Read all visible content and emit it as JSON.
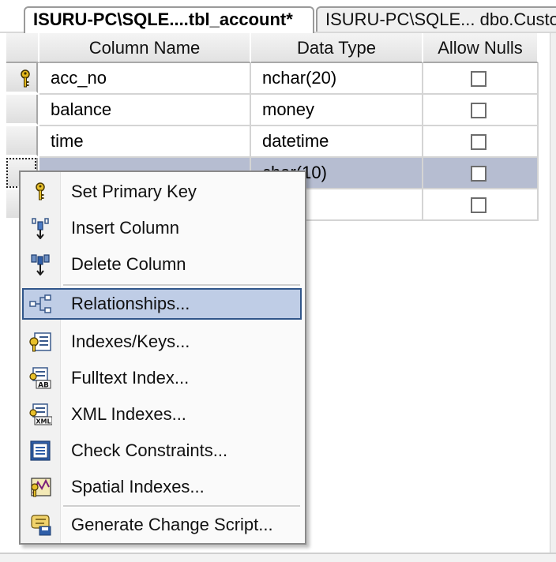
{
  "tabs": [
    {
      "label": "ISURU-PC\\SQLE....tbl_account*",
      "active": true
    },
    {
      "label": "ISURU-PC\\SQLE... dbo.Custo",
      "active": false
    }
  ],
  "grid": {
    "headers": {
      "column_name": "Column Name",
      "data_type": "Data Type",
      "allow_nulls": "Allow Nulls"
    },
    "rows": [
      {
        "name": "acc_no",
        "type": "nchar(20)",
        "allow_nulls": false,
        "primary_key": true
      },
      {
        "name": "balance",
        "type": "money",
        "allow_nulls": false,
        "primary_key": false
      },
      {
        "name": "time",
        "type": "datetime",
        "allow_nulls": false,
        "primary_key": false
      },
      {
        "name": "",
        "type": "char(10)",
        "allow_nulls": false,
        "primary_key": false,
        "selected": true
      },
      {
        "name": "",
        "type": "",
        "allow_nulls": false,
        "primary_key": false
      }
    ]
  },
  "context_menu": {
    "highlighted": "Relationships...",
    "items": [
      {
        "label": "Set Primary Key",
        "icon": "key-icon"
      },
      {
        "label": "Insert Column",
        "icon": "insert-column-icon"
      },
      {
        "label": "Delete Column",
        "icon": "delete-column-icon"
      },
      {
        "label": "Relationships...",
        "icon": "relationships-icon"
      },
      {
        "label": "Indexes/Keys...",
        "icon": "indexes-keys-icon"
      },
      {
        "label": "Fulltext Index...",
        "icon": "fulltext-index-icon"
      },
      {
        "label": "XML Indexes...",
        "icon": "xml-indexes-icon"
      },
      {
        "label": "Check Constraints...",
        "icon": "check-constraints-icon"
      },
      {
        "label": "Spatial Indexes...",
        "icon": "spatial-indexes-icon"
      },
      {
        "label": "Generate Change Script...",
        "icon": "generate-change-script-icon"
      }
    ]
  },
  "colors": {
    "selection": "#b6bdd1",
    "menu_highlight": "#bfcde6",
    "menu_highlight_border": "#31568a"
  }
}
